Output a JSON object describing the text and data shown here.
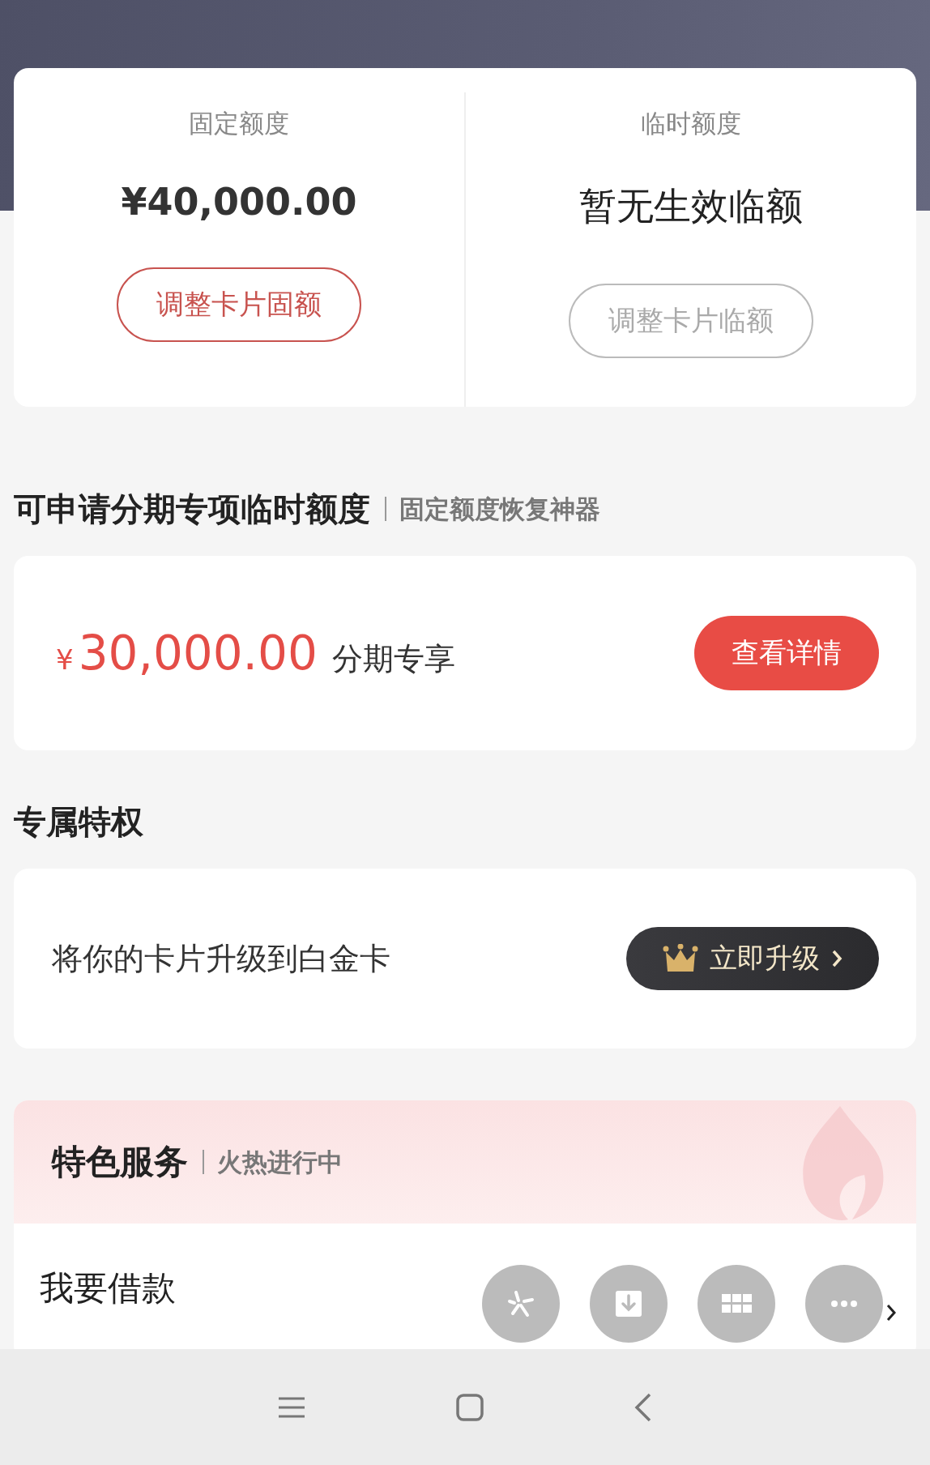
{
  "limits": [
    {
      "label": "固定额度",
      "kind": "amount",
      "value": "¥40,000.00",
      "button": "调整卡片固额",
      "disabled": false
    },
    {
      "label": "临时额度",
      "kind": "message",
      "value": "暂无生效临额",
      "button": "调整卡片临额",
      "disabled": true
    }
  ],
  "installment": {
    "title": "可申请分期专项临时额度",
    "subtitle": "固定额度恢复神器",
    "currency": "¥",
    "amount": "30,000.00",
    "label": "分期专享",
    "button": "查看详情"
  },
  "privilege": {
    "title": "专属特权",
    "text": "将你的卡片升级到白金卡",
    "button": "立即升级"
  },
  "services": {
    "title": "特色服务",
    "subtitle": "火热进行中",
    "items": [
      {
        "label": "我要借款"
      }
    ]
  }
}
